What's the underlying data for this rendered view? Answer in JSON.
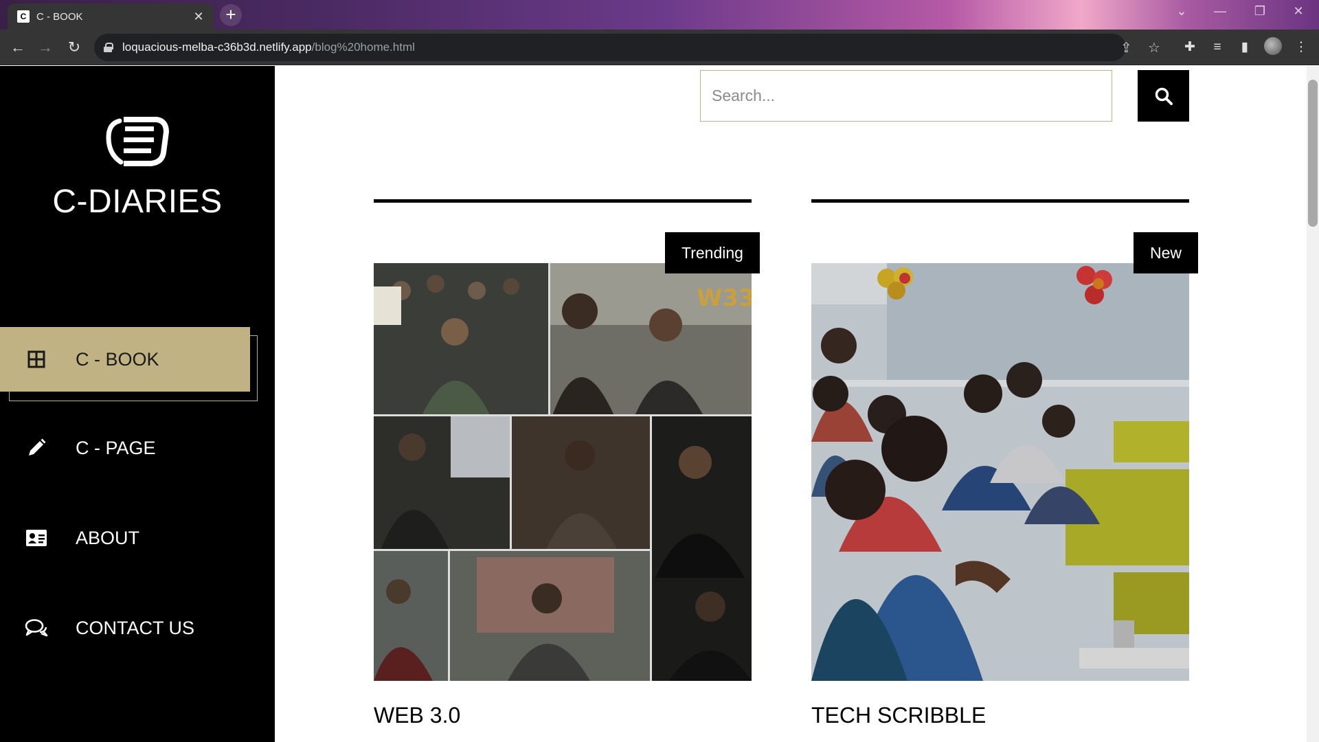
{
  "browser": {
    "tab_title": "C - BOOK",
    "tab_favicon": "C",
    "url_host": "loquacious-melba-c36b3d.netlify.app",
    "url_path": "/blog%20home.html"
  },
  "sidebar": {
    "brand": "C-DIARIES",
    "items": [
      {
        "label": "C - BOOK",
        "icon": "grid-icon",
        "active": true
      },
      {
        "label": "C - PAGE",
        "icon": "pencil-icon",
        "active": false
      },
      {
        "label": "ABOUT",
        "icon": "id-card-icon",
        "active": false
      },
      {
        "label": "CONTACT US",
        "icon": "chat-bubbles-icon",
        "active": false
      }
    ]
  },
  "search": {
    "placeholder": "Search...",
    "icon": "search-icon"
  },
  "cards": [
    {
      "badge": "Trending",
      "title": "WEB 3.0"
    },
    {
      "badge": "New",
      "title": "TECH SCRIBBLE"
    }
  ],
  "colors": {
    "accent": "#c0b283",
    "sidebar_bg": "#000000"
  }
}
